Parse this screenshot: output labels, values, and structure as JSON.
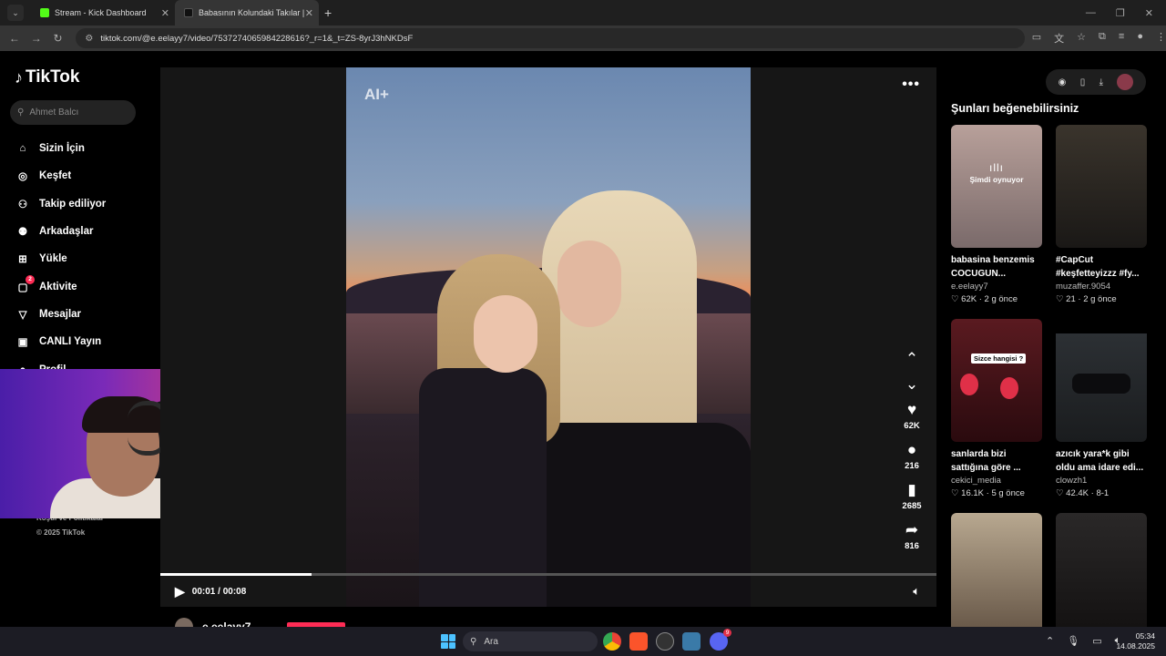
{
  "browser": {
    "tabs": [
      {
        "title": "Stream - Kick Dashboard",
        "favicon_color": "#53fc18",
        "active": false
      },
      {
        "title": "Babasının Kolundaki Takılar | Til",
        "favicon_color": "#111111",
        "active": true
      }
    ],
    "new_tab": "+",
    "url": "tiktok.com/@e.eelayy7/video/7537274065984228616?_r=1&_t=ZS-8yrJ3hNKDsF"
  },
  "sidebar": {
    "logo": "TikTok",
    "search_placeholder": "Ahmet Balcı",
    "items": [
      {
        "label": "Sizin İçin",
        "icon": "home-icon"
      },
      {
        "label": "Keşfet",
        "icon": "compass-icon"
      },
      {
        "label": "Takip ediliyor",
        "icon": "following-icon"
      },
      {
        "label": "Arkadaşlar",
        "icon": "friends-icon"
      },
      {
        "label": "Yükle",
        "icon": "upload-icon"
      },
      {
        "label": "Aktivite",
        "icon": "activity-icon",
        "badge": "2"
      },
      {
        "label": "Mesajlar",
        "icon": "messages-icon"
      },
      {
        "label": "CANLI Yayın",
        "icon": "live-icon"
      },
      {
        "label": "Profil",
        "icon": "profile-icon"
      }
    ],
    "footer": {
      "links": "Koşul ve Politikalar",
      "copyright": "© 2025 TikTok"
    }
  },
  "player": {
    "ai_tag": "AI+",
    "more": "•••",
    "likes": "62K",
    "comments": "216",
    "saves": "2685",
    "shares": "816",
    "time": "00:01 / 00:08",
    "progress": 0.195,
    "author": "e.eelayy7"
  },
  "recommendations": {
    "title": "Şunları beğenebilirsiniz",
    "now_playing": "Şimdi oynuyor",
    "cards": [
      {
        "desc": "babasina benzemis\nCOCUGUN...",
        "user": "e.eelayy7",
        "likes": "62K",
        "age": "2 g önce",
        "thumb": "#8a7878"
      },
      {
        "desc": "#CapCut\n#keşfetteyizzz #fy...",
        "user": "muzaffer.9054",
        "likes": "21",
        "age": "2 g önce",
        "thumb": "#2a2622"
      },
      {
        "desc": "sanlarda bizi\nsattığına göre ...",
        "user": "cekici_media",
        "likes": "16.1K",
        "age": "5 g önce",
        "thumb": "#3a1014",
        "overlay": "Sizce hangisi ?"
      },
      {
        "desc": "azıcık yara*k gibi\noldu ama idare edi...",
        "user": "clowzh1",
        "likes": "42.4K",
        "age": "8-1",
        "thumb": "#24282c"
      },
      {
        "desc": "",
        "user": "",
        "likes": "",
        "age": "",
        "thumb": "#a09078"
      },
      {
        "desc": "",
        "user": "",
        "likes": "",
        "age": "",
        "thumb": "#1e1c1c"
      }
    ]
  },
  "taskbar": {
    "search": "Ara",
    "time": "05:34",
    "date": "14.08.2025",
    "discord_badge": "9"
  }
}
